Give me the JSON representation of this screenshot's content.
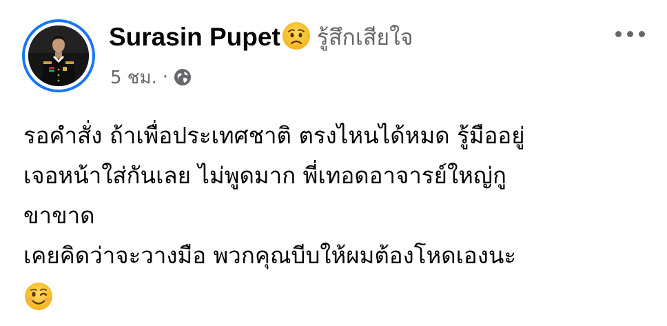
{
  "post": {
    "author_name": "Surasin Pupet",
    "feeling_emoji_icon": "worried-face-icon",
    "feeling_text": "รู้สึกเสียใจ",
    "timestamp": "5 ชม.",
    "separator": "·",
    "privacy_icon": "globe-icon",
    "more_icon": "more-options-icon",
    "body_lines": [
      "รอคำสั่ง ถ้าเพื่อประเทศชาติ ตรงไหนได้หมด รู้มืออยู่",
      "เจอหน้าใส่กันเลย ไม่พูดมาก พี่เทอดอาจารย์ใหญ่กู",
      "ขาขาด",
      "เคยคิดว่าจะวางมือ พวกคุณบีบให้ผมต้องโหดเองนะ"
    ],
    "body_emoji_icon": "winking-face-icon"
  },
  "colors": {
    "avatar_ring": "#1877f2",
    "text_primary": "#050505",
    "text_secondary": "#65676b"
  }
}
